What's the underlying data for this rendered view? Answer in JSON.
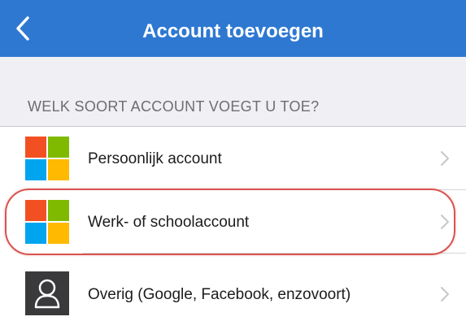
{
  "navbar": {
    "title": "Account toevoegen",
    "back_icon": "chevron-left-icon",
    "background": "#2e78d2"
  },
  "section": {
    "header": "WELK SOORT ACCOUNT VOEGT U TOE?"
  },
  "accounts": [
    {
      "label": "Persoonlijk account",
      "icon": "microsoft-logo-icon"
    },
    {
      "label": "Werk- of schoolaccount",
      "icon": "microsoft-logo-icon",
      "highlighted": true
    },
    {
      "label": "Overig (Google, Facebook, enzovoort)",
      "icon": "person-icon"
    }
  ],
  "colors": {
    "ms_red": "#f25022",
    "ms_green": "#7fba00",
    "ms_blue": "#00a4ef",
    "ms_yellow": "#ffb900",
    "highlight": "#d9534f"
  }
}
